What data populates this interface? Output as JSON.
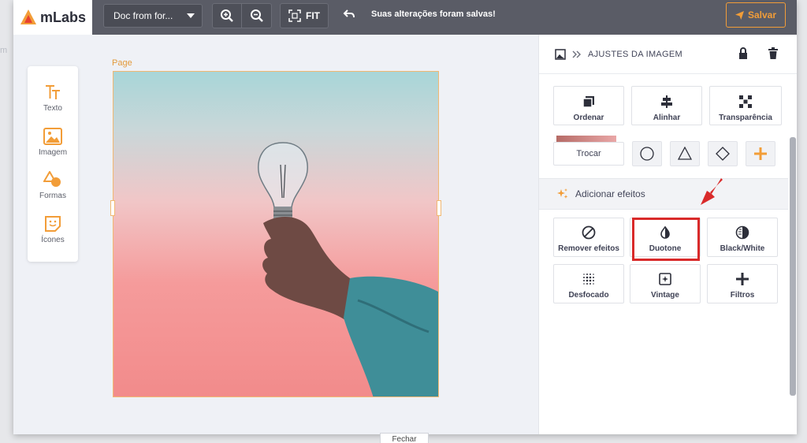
{
  "app": {
    "logo_text": "mLabs"
  },
  "toolbar": {
    "document_name": "Doc from for...",
    "fit_label": "FIT",
    "status_text": "Suas alterações foram salvas!",
    "save_label": "Salvar"
  },
  "tools": [
    {
      "label": "Texto",
      "icon": "text-icon"
    },
    {
      "label": "Imagem",
      "icon": "image-icon"
    },
    {
      "label": "Formas",
      "icon": "shapes-icon"
    },
    {
      "label": "Ícones",
      "icon": "sticker-icon"
    }
  ],
  "canvas": {
    "page_label": "Page"
  },
  "panel": {
    "title": "AJUSTES DA IMAGEM",
    "top_buttons": [
      {
        "label": "Ordenar",
        "icon": "layers-icon"
      },
      {
        "label": "Alinhar",
        "icon": "align-icon"
      },
      {
        "label": "Transparência",
        "icon": "transparency-icon"
      }
    ],
    "swap_label": "Trocar",
    "effects_section_label": "Adicionar efeitos",
    "effects": [
      {
        "label": "Remover efeitos",
        "icon": "no-effect-icon"
      },
      {
        "label": "Duotone",
        "icon": "duotone-icon"
      },
      {
        "label": "Black/White",
        "icon": "black-white-icon"
      },
      {
        "label": "Desfocado",
        "icon": "blur-icon"
      },
      {
        "label": "Vintage",
        "icon": "vintage-icon"
      },
      {
        "label": "Filtros",
        "icon": "plus-icon"
      }
    ]
  },
  "footer": {
    "close_label": "Fechar"
  },
  "colors": {
    "accent": "#f29d38",
    "topbar": "#5a5c66",
    "highlight": "#d92a2a"
  }
}
